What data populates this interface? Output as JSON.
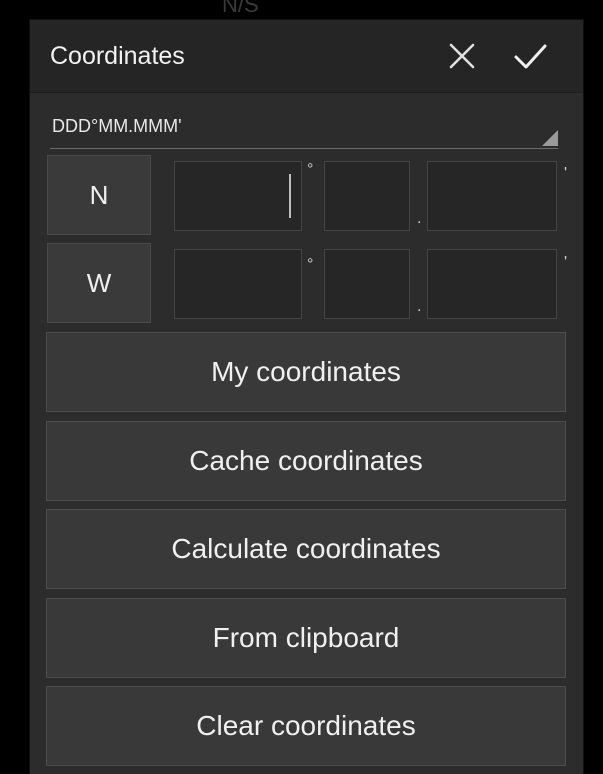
{
  "background_hint": "N/S",
  "dialog": {
    "title": "Coordinates",
    "close_icon": "close-icon",
    "confirm_icon": "check-icon"
  },
  "format": {
    "selected": "DDD°MM.MMM'"
  },
  "latitude": {
    "hemisphere": "N",
    "degrees": "",
    "minutes": "",
    "fraction": "",
    "deg_symbol": "°",
    "dot": ".",
    "min_symbol": "'"
  },
  "longitude": {
    "hemisphere": "W",
    "degrees": "",
    "minutes": "",
    "fraction": "",
    "deg_symbol": "°",
    "dot": ".",
    "min_symbol": "'"
  },
  "actions": {
    "my_coordinates": "My coordinates",
    "cache_coordinates": "Cache coordinates",
    "calculate_coordinates": "Calculate coordinates",
    "from_clipboard": "From clipboard",
    "clear_coordinates": "Clear coordinates"
  },
  "colors": {
    "dialog_bg": "#2c2c2c",
    "button_bg": "#393939",
    "text": "#f0f0f0"
  }
}
